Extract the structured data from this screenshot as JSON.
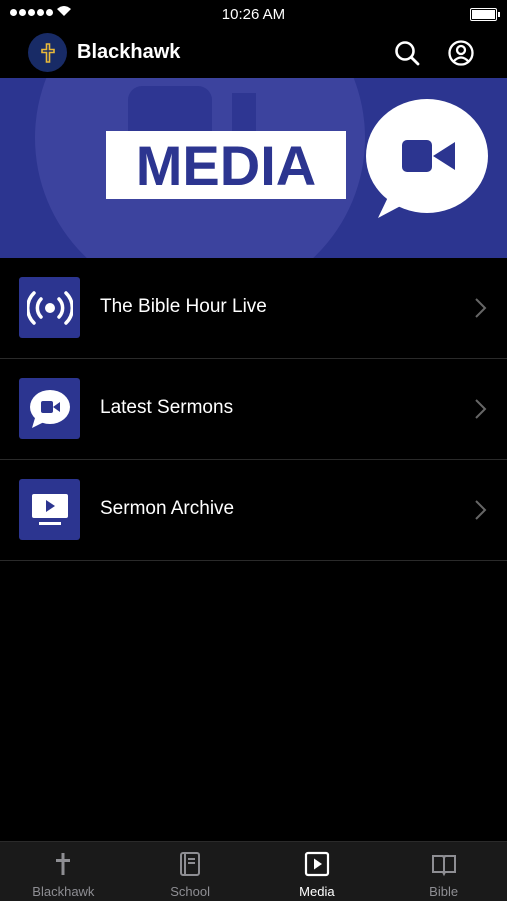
{
  "status_bar": {
    "time": "10:26 AM"
  },
  "header": {
    "title": "Blackhawk"
  },
  "banner": {
    "text": "MEDIA"
  },
  "list": {
    "items": [
      {
        "label": "The Bible Hour Live",
        "icon": "live-broadcast-icon"
      },
      {
        "label": "Latest Sermons",
        "icon": "video-chat-icon"
      },
      {
        "label": "Sermon Archive",
        "icon": "tv-play-icon"
      }
    ]
  },
  "tabbar": {
    "tabs": [
      {
        "label": "Blackhawk",
        "icon": "cross-icon"
      },
      {
        "label": "School",
        "icon": "book-icon"
      },
      {
        "label": "Media",
        "icon": "play-icon",
        "active": true
      },
      {
        "label": "Bible",
        "icon": "open-book-icon"
      }
    ]
  },
  "colors": {
    "accent": "#2c3590",
    "background": "#000000",
    "tabbar": "#1a1a1a",
    "inactive": "#8e8e93"
  }
}
